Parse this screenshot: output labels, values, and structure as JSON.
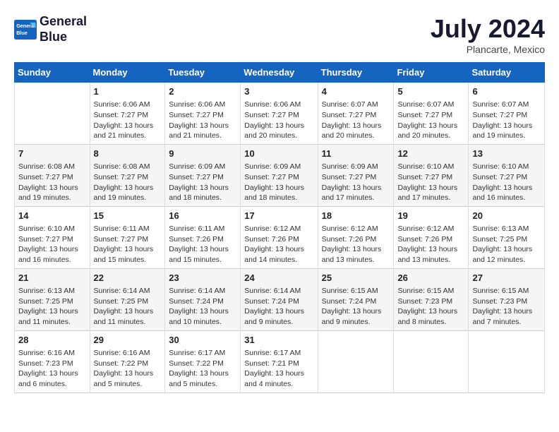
{
  "header": {
    "logo_line1": "General",
    "logo_line2": "Blue",
    "month_year": "July 2024",
    "location": "Plancarte, Mexico"
  },
  "days_of_week": [
    "Sunday",
    "Monday",
    "Tuesday",
    "Wednesday",
    "Thursday",
    "Friday",
    "Saturday"
  ],
  "weeks": [
    [
      {
        "day": "",
        "info": ""
      },
      {
        "day": "1",
        "info": "Sunrise: 6:06 AM\nSunset: 7:27 PM\nDaylight: 13 hours\nand 21 minutes."
      },
      {
        "day": "2",
        "info": "Sunrise: 6:06 AM\nSunset: 7:27 PM\nDaylight: 13 hours\nand 21 minutes."
      },
      {
        "day": "3",
        "info": "Sunrise: 6:06 AM\nSunset: 7:27 PM\nDaylight: 13 hours\nand 20 minutes."
      },
      {
        "day": "4",
        "info": "Sunrise: 6:07 AM\nSunset: 7:27 PM\nDaylight: 13 hours\nand 20 minutes."
      },
      {
        "day": "5",
        "info": "Sunrise: 6:07 AM\nSunset: 7:27 PM\nDaylight: 13 hours\nand 20 minutes."
      },
      {
        "day": "6",
        "info": "Sunrise: 6:07 AM\nSunset: 7:27 PM\nDaylight: 13 hours\nand 19 minutes."
      }
    ],
    [
      {
        "day": "7",
        "info": "Sunrise: 6:08 AM\nSunset: 7:27 PM\nDaylight: 13 hours\nand 19 minutes."
      },
      {
        "day": "8",
        "info": "Sunrise: 6:08 AM\nSunset: 7:27 PM\nDaylight: 13 hours\nand 19 minutes."
      },
      {
        "day": "9",
        "info": "Sunrise: 6:09 AM\nSunset: 7:27 PM\nDaylight: 13 hours\nand 18 minutes."
      },
      {
        "day": "10",
        "info": "Sunrise: 6:09 AM\nSunset: 7:27 PM\nDaylight: 13 hours\nand 18 minutes."
      },
      {
        "day": "11",
        "info": "Sunrise: 6:09 AM\nSunset: 7:27 PM\nDaylight: 13 hours\nand 17 minutes."
      },
      {
        "day": "12",
        "info": "Sunrise: 6:10 AM\nSunset: 7:27 PM\nDaylight: 13 hours\nand 17 minutes."
      },
      {
        "day": "13",
        "info": "Sunrise: 6:10 AM\nSunset: 7:27 PM\nDaylight: 13 hours\nand 16 minutes."
      }
    ],
    [
      {
        "day": "14",
        "info": "Sunrise: 6:10 AM\nSunset: 7:27 PM\nDaylight: 13 hours\nand 16 minutes."
      },
      {
        "day": "15",
        "info": "Sunrise: 6:11 AM\nSunset: 7:27 PM\nDaylight: 13 hours\nand 15 minutes."
      },
      {
        "day": "16",
        "info": "Sunrise: 6:11 AM\nSunset: 7:26 PM\nDaylight: 13 hours\nand 15 minutes."
      },
      {
        "day": "17",
        "info": "Sunrise: 6:12 AM\nSunset: 7:26 PM\nDaylight: 13 hours\nand 14 minutes."
      },
      {
        "day": "18",
        "info": "Sunrise: 6:12 AM\nSunset: 7:26 PM\nDaylight: 13 hours\nand 13 minutes."
      },
      {
        "day": "19",
        "info": "Sunrise: 6:12 AM\nSunset: 7:26 PM\nDaylight: 13 hours\nand 13 minutes."
      },
      {
        "day": "20",
        "info": "Sunrise: 6:13 AM\nSunset: 7:25 PM\nDaylight: 13 hours\nand 12 minutes."
      }
    ],
    [
      {
        "day": "21",
        "info": "Sunrise: 6:13 AM\nSunset: 7:25 PM\nDaylight: 13 hours\nand 11 minutes."
      },
      {
        "day": "22",
        "info": "Sunrise: 6:14 AM\nSunset: 7:25 PM\nDaylight: 13 hours\nand 11 minutes."
      },
      {
        "day": "23",
        "info": "Sunrise: 6:14 AM\nSunset: 7:24 PM\nDaylight: 13 hours\nand 10 minutes."
      },
      {
        "day": "24",
        "info": "Sunrise: 6:14 AM\nSunset: 7:24 PM\nDaylight: 13 hours\nand 9 minutes."
      },
      {
        "day": "25",
        "info": "Sunrise: 6:15 AM\nSunset: 7:24 PM\nDaylight: 13 hours\nand 9 minutes."
      },
      {
        "day": "26",
        "info": "Sunrise: 6:15 AM\nSunset: 7:23 PM\nDaylight: 13 hours\nand 8 minutes."
      },
      {
        "day": "27",
        "info": "Sunrise: 6:15 AM\nSunset: 7:23 PM\nDaylight: 13 hours\nand 7 minutes."
      }
    ],
    [
      {
        "day": "28",
        "info": "Sunrise: 6:16 AM\nSunset: 7:23 PM\nDaylight: 13 hours\nand 6 minutes."
      },
      {
        "day": "29",
        "info": "Sunrise: 6:16 AM\nSunset: 7:22 PM\nDaylight: 13 hours\nand 5 minutes."
      },
      {
        "day": "30",
        "info": "Sunrise: 6:17 AM\nSunset: 7:22 PM\nDaylight: 13 hours\nand 5 minutes."
      },
      {
        "day": "31",
        "info": "Sunrise: 6:17 AM\nSunset: 7:21 PM\nDaylight: 13 hours\nand 4 minutes."
      },
      {
        "day": "",
        "info": ""
      },
      {
        "day": "",
        "info": ""
      },
      {
        "day": "",
        "info": ""
      }
    ]
  ]
}
